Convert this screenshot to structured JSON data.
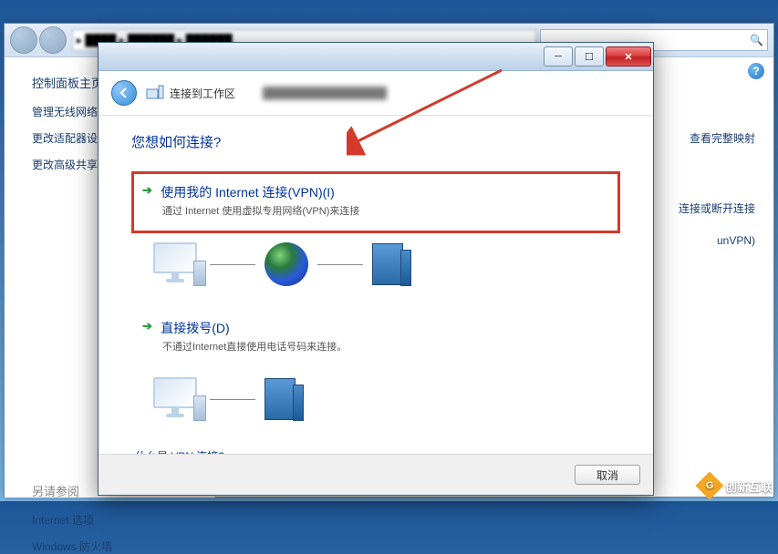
{
  "bg": {
    "heading": "控制面板主页",
    "links": [
      "管理无线网络",
      "更改适配器设置",
      "更改高级共享"
    ],
    "section2_heading": "另请参阅",
    "section2_links": [
      "Internet 选项",
      "Windows 防火墙"
    ],
    "right_links": [
      "查看完整映射",
      "连接或断开连接",
      "unVPN)"
    ]
  },
  "dialog": {
    "title": "连接到工作区",
    "prompt": "您想如何连接?",
    "option1": {
      "title": "使用我的 Internet 连接(VPN)(I)",
      "desc": "通过 Internet 使用虚拟专用网络(VPN)来连接"
    },
    "option2": {
      "title": "直接拨号(D)",
      "desc": "不通过Internet直接使用电话号码来连接。"
    },
    "vpn_link": "什么是 VPN 连接?",
    "cancel": "取消"
  },
  "watermark": "创新互联"
}
